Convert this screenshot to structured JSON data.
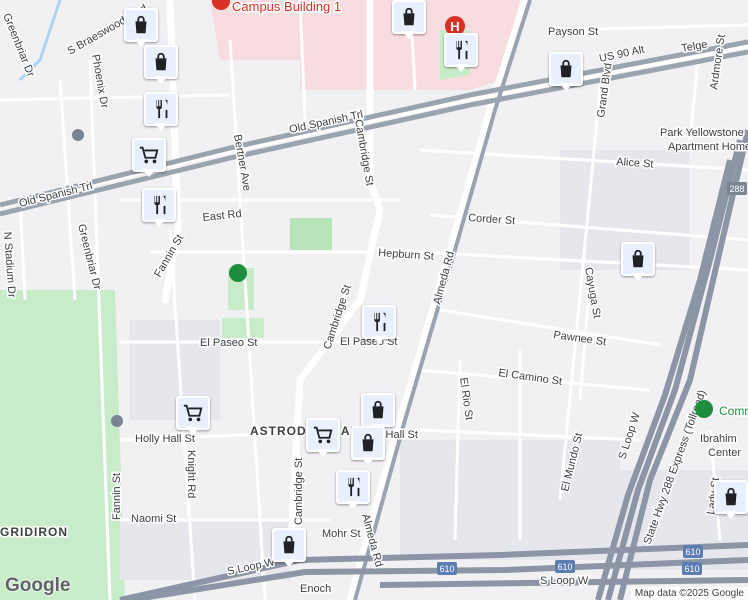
{
  "map": {
    "attribution": "Map data ©2025 Google",
    "logo": "Google",
    "colors": {
      "road": "#ffffff",
      "highway": "#8b95a5",
      "park": "#c8ecc9",
      "medical": "#f8dde0",
      "block": "#e6e7ec",
      "pin": "#1a73e8"
    },
    "labels": {
      "old_spanish_trl_w": "Old Spanish Trl",
      "old_spanish_trl_e": "Old Spanish Trl",
      "cambridge_st_n": "Cambridge St",
      "cambridge_st_mid": "Cambridge St",
      "cambridge_st_s": "Cambridge St",
      "almeda_rd": "Almeda Rd",
      "almeda_rd_s": "Almeda Rd",
      "hepburn_st": "Hepburn St",
      "corder_st": "Corder St",
      "alice_st": "Alice St",
      "payson_st": "Payson St",
      "telge": "Telge",
      "us_90_alt": "US 90 Alt",
      "grand_blvd": "Grand Blvd",
      "ardmore_st": "Ardmore St",
      "ardmore_st_n": "Ardmore St",
      "park_yellowstone": "Park Yellowstone",
      "apartment_homes": "Apartment Homes",
      "east_rd": "East Rd",
      "fannin_st_n": "Fannin St",
      "fannin_st_s": "Fannin St",
      "bertner_ave": "Bertner Ave",
      "greenbriar_dr_n": "Greenbriar Dr",
      "greenbriar_dr_s": "Greenbriar Dr",
      "n_stadium_dr": "N Stadium Dr",
      "s_braeswood_blvd": "S Braeswood Blvd",
      "phoenix_dr": "Phoenix Dr",
      "el_paseo_st": "El Paseo St",
      "el_paseo_st2": "El Paseo St",
      "pawnee_st": "Pawnee St",
      "cayuga_st": "Cayuga St",
      "el_camino_st": "El Camino St",
      "el_rio_st": "El Rio St",
      "el_mundo_st": "El Mundo St",
      "holly_hall_st": "Holly Hall St",
      "holly_hall_st2": "Holly Hall St",
      "astrodome_area": "ASTRODOME AREA",
      "knight_rd": "Knight Rd",
      "naomi_st": "Naomi St",
      "mohr_st": "Mohr St",
      "s_loop_w": "S Loop W",
      "s_loop_w2": "S Loop W",
      "s_loop_w3": "S Loop W",
      "enoch": "Enoch",
      "lady_st": "Lady St",
      "state_hwy_288": "State Hwy 288 Express (Tollroad)",
      "campus_building": "Campus Building 1",
      "gridiron": "GRIDIRON",
      "comm": "Comm",
      "ibrahim": "Ibrahim",
      "center": "Center",
      "shield_610_a": "610",
      "shield_610_b": "610",
      "shield_610_c": "610",
      "shield_610_d": "610",
      "shield_288": "288"
    },
    "pins": [
      {
        "name": "shopping-bag",
        "icon": "bag"
      },
      {
        "name": "shopping-bag",
        "icon": "bag"
      },
      {
        "name": "restaurant",
        "icon": "fork-knife"
      },
      {
        "name": "grocery-store",
        "icon": "cart"
      },
      {
        "name": "restaurant",
        "icon": "fork-knife"
      },
      {
        "name": "shopping-bag",
        "icon": "bag"
      },
      {
        "name": "restaurant",
        "icon": "fork-knife"
      },
      {
        "name": "shopping-bag",
        "icon": "bag"
      },
      {
        "name": "shopping-bag",
        "icon": "bag"
      },
      {
        "name": "restaurant",
        "icon": "fork-knife"
      },
      {
        "name": "grocery-store",
        "icon": "cart"
      },
      {
        "name": "grocery-store",
        "icon": "cart"
      },
      {
        "name": "shopping-bag",
        "icon": "bag"
      },
      {
        "name": "shopping-bag",
        "icon": "bag"
      },
      {
        "name": "restaurant",
        "icon": "fork-knife"
      },
      {
        "name": "shopping-bag",
        "icon": "bag"
      },
      {
        "name": "shopping-bag",
        "icon": "bag"
      }
    ]
  }
}
